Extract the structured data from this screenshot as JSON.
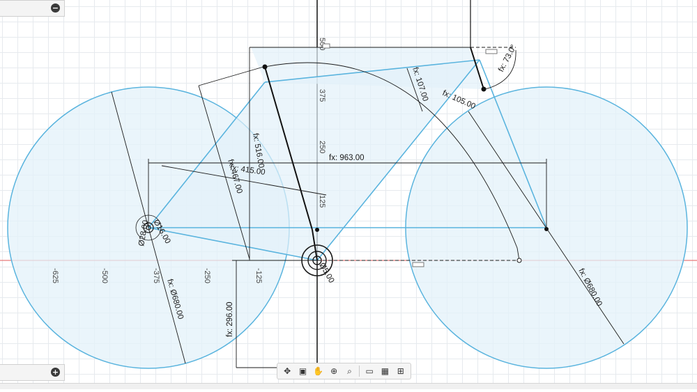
{
  "panels": {
    "top_toggle": "−",
    "bottom_toggle": "+"
  },
  "axis_ticks": {
    "h": [
      "-625",
      "-500",
      "-375",
      "-250",
      "-125"
    ],
    "v": [
      "500",
      "375",
      "250",
      "125"
    ]
  },
  "dimensions": {
    "wheelbase": "fx: 963.00",
    "seat_tube": "fx: 516.00",
    "top_tube": "fx: 415.00",
    "chainstay": "fx: 467.00",
    "head_tube": "fx: 107.00",
    "stem": "fx: 105.00",
    "head_angle": "fx: 73.0°",
    "front_wheel": "fx: Ø680.00",
    "rear_wheel": "fx: Ø680.00",
    "bb_drop": "fx: 296.00",
    "hub_small": "Ø28.00",
    "hub_small2": "Ø16.00",
    "bb_dia": "Ø5.00"
  },
  "colors": {
    "sketch": "#5ab4de",
    "fill": "#e3f1fa",
    "dim": "#1a1a1a",
    "axis_red": "#e05a5a"
  },
  "toolbar": {
    "icons": [
      "orbit-icon",
      "look-at-icon",
      "pan-icon",
      "zoom-window-icon",
      "fit-icon",
      "display-settings-icon",
      "grid-icon",
      "viewports-icon"
    ]
  }
}
